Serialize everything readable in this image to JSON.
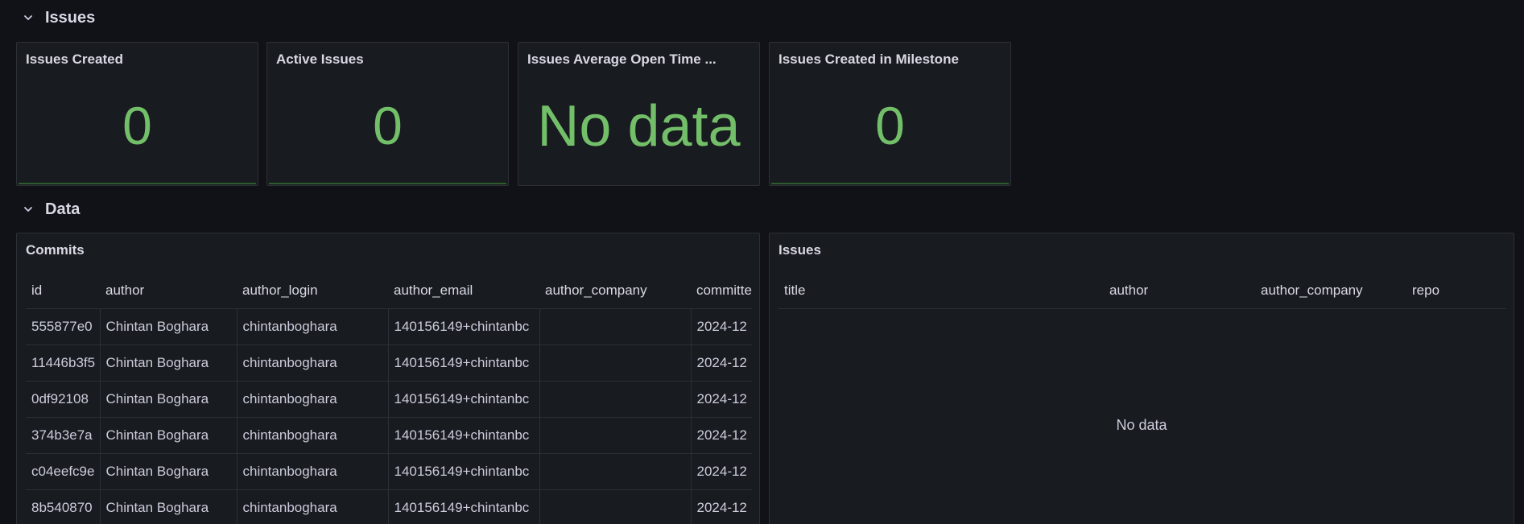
{
  "rows": {
    "issues_row": {
      "title": "Issues"
    },
    "data_row": {
      "title": "Data"
    }
  },
  "stats": [
    {
      "title": "Issues Created",
      "value": "0"
    },
    {
      "title": "Active Issues",
      "value": "0"
    },
    {
      "title": "Issues Average Open Time ...",
      "value": "No data"
    },
    {
      "title": "Issues Created in Milestone",
      "value": "0"
    }
  ],
  "commits": {
    "title": "Commits",
    "columns": [
      "id",
      "author",
      "author_login",
      "author_email",
      "author_company",
      "committe"
    ],
    "rows": [
      [
        "555877e0",
        "Chintan Boghara",
        "chintanboghara",
        "140156149+chintanbc",
        "",
        "2024-12"
      ],
      [
        "11446b3f5",
        "Chintan Boghara",
        "chintanboghara",
        "140156149+chintanbc",
        "",
        "2024-12"
      ],
      [
        "0df92108",
        "Chintan Boghara",
        "chintanboghara",
        "140156149+chintanbc",
        "",
        "2024-12"
      ],
      [
        "374b3e7a",
        "Chintan Boghara",
        "chintanboghara",
        "140156149+chintanbc",
        "",
        "2024-12"
      ],
      [
        "c04eefc9e",
        "Chintan Boghara",
        "chintanboghara",
        "140156149+chintanbc",
        "",
        "2024-12"
      ],
      [
        "8b540870",
        "Chintan Boghara",
        "chintanboghara",
        "140156149+chintanbc",
        "",
        "2024-12"
      ]
    ]
  },
  "issues_table": {
    "title": "Issues",
    "columns": [
      "title",
      "author",
      "author_company",
      "repo"
    ],
    "empty_text": "No data"
  },
  "colors": {
    "background": "#111217",
    "panel": "#181b1f",
    "border": "#2c2f36",
    "stat_green": "#73bf69",
    "text": "#ccccdc"
  },
  "icons": {
    "row_collapse": "chevron-down-icon"
  }
}
